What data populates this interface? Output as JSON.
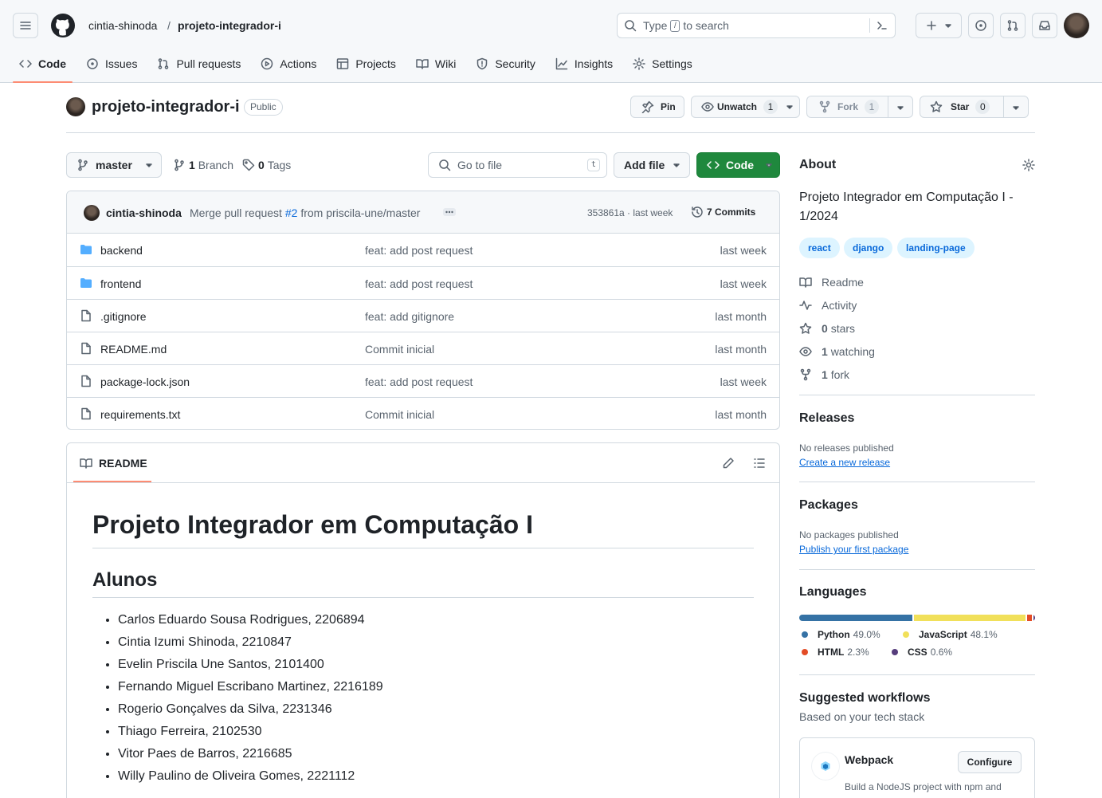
{
  "header": {
    "owner": "cintia-shinoda",
    "separator": "/",
    "repo": "projeto-integrador-i",
    "search_prefix": "Type",
    "search_key": "/",
    "search_suffix": "to search"
  },
  "tabs": [
    {
      "label": "Code",
      "icon": "code-icon"
    },
    {
      "label": "Issues",
      "icon": "issue-icon"
    },
    {
      "label": "Pull requests",
      "icon": "pull-request-icon"
    },
    {
      "label": "Actions",
      "icon": "play-icon"
    },
    {
      "label": "Projects",
      "icon": "table-icon"
    },
    {
      "label": "Wiki",
      "icon": "book-icon"
    },
    {
      "label": "Security",
      "icon": "shield-icon"
    },
    {
      "label": "Insights",
      "icon": "graph-icon"
    },
    {
      "label": "Settings",
      "icon": "gear-icon"
    }
  ],
  "repohead": {
    "name": "projeto-integrador-i",
    "visibility": "Public",
    "pin": "Pin",
    "unwatch": "Unwatch",
    "watch_count": "1",
    "fork": "Fork",
    "fork_count": "1",
    "star": "Star",
    "star_count": "0"
  },
  "toolbar": {
    "branch": "master",
    "branch_count": "1",
    "branch_label": "Branch",
    "tag_count": "0",
    "tag_label": "Tags",
    "goto_placeholder": "Go to file",
    "goto_key": "t",
    "add_file": "Add file",
    "code": "Code"
  },
  "commit": {
    "author": "cintia-shinoda",
    "message_prefix": "Merge pull request",
    "pr": "#2",
    "message_suffix": "from priscila-une/master",
    "meta": "353861a · last week",
    "commits": "7 Commits"
  },
  "files": [
    {
      "type": "dir",
      "name": "backend",
      "message": "feat: add post request",
      "date": "last week"
    },
    {
      "type": "dir",
      "name": "frontend",
      "message": "feat: add post request",
      "date": "last week"
    },
    {
      "type": "file",
      "name": ".gitignore",
      "message": "feat: add gitignore",
      "date": "last month"
    },
    {
      "type": "file",
      "name": "README.md",
      "message": "Commit inicial",
      "date": "last month"
    },
    {
      "type": "file",
      "name": "package-lock.json",
      "message": "feat: add post request",
      "date": "last week"
    },
    {
      "type": "file",
      "name": "requirements.txt",
      "message": "Commit inicial",
      "date": "last month"
    }
  ],
  "readme": {
    "tab": "README",
    "h1": "Projeto Integrador em Computação I",
    "h2": "Alunos",
    "students": [
      "Carlos Eduardo Sousa Rodrigues, 2206894",
      "Cintia Izumi Shinoda, 2210847",
      "Evelin Priscila Une Santos, 2101400",
      "Fernando Miguel Escribano Martinez, 2216189",
      "Rogerio Gonçalves da Silva, 2231346",
      "Thiago Ferreira, 2102530",
      "Vitor Paes de Barros, 2216685",
      "Willy Paulino de Oliveira Gomes, 2221112"
    ]
  },
  "about": {
    "title": "About",
    "description": "Projeto Integrador em Computação I - 1/2024",
    "topics": [
      "react",
      "django",
      "landing-page"
    ],
    "readme": "Readme",
    "activity": "Activity",
    "stars_count": "0",
    "stars_label": "stars",
    "watching_count": "1",
    "watching_label": "watching",
    "fork_count": "1",
    "fork_label": "fork"
  },
  "releases": {
    "title": "Releases",
    "empty": "No releases published",
    "link": "Create a new release"
  },
  "packages": {
    "title": "Packages",
    "empty": "No packages published",
    "link": "Publish your first package"
  },
  "languages": {
    "title": "Languages",
    "items": [
      {
        "name": "Python",
        "percent": 49.0,
        "label": "49.0%",
        "color": "#3572A5"
      },
      {
        "name": "JavaScript",
        "percent": 48.1,
        "label": "48.1%",
        "color": "#f1e05a"
      },
      {
        "name": "HTML",
        "percent": 2.3,
        "label": "2.3%",
        "color": "#e34c26"
      },
      {
        "name": "CSS",
        "percent": 0.6,
        "label": "0.6%",
        "color": "#563d7c"
      }
    ]
  },
  "workflows": {
    "title": "Suggested workflows",
    "subtitle": "Based on your tech stack",
    "name": "Webpack",
    "configure": "Configure",
    "description": "Build a NodeJS project with npm and"
  },
  "colors": {
    "accent": "#fd8c73",
    "primary_green": "#1f883d",
    "link": "#0969da",
    "folder": "#54aeff"
  }
}
